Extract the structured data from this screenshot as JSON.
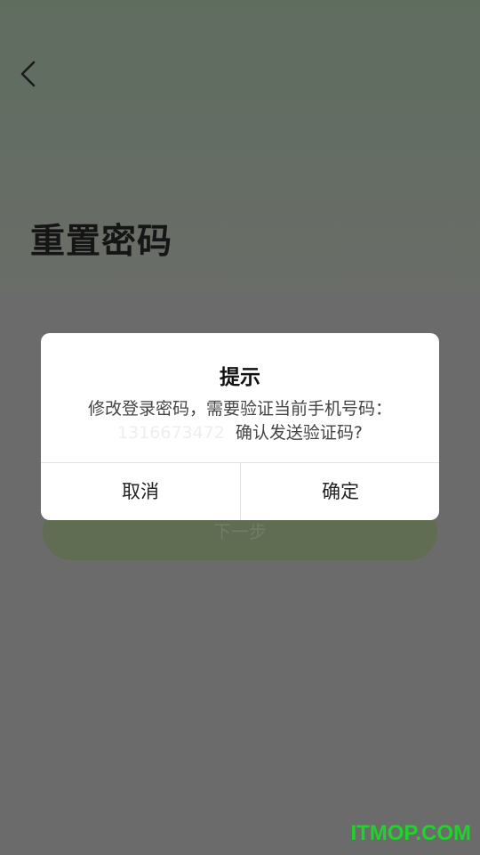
{
  "page": {
    "title": "重置密码",
    "next_label": "下一步"
  },
  "dialog": {
    "title": "提示",
    "message_line1": "修改登录密码，需要验证当前手机号码：",
    "phone_masked": "1316673472",
    "message_line2_suffix": "确认发送验证码?",
    "cancel_label": "取消",
    "ok_label": "确定"
  },
  "watermark": "ITMOP.COM",
  "icons": {
    "back": "chevron-left-icon"
  },
  "colors": {
    "accent": "#606d52",
    "watermark": "#1fd32a"
  }
}
